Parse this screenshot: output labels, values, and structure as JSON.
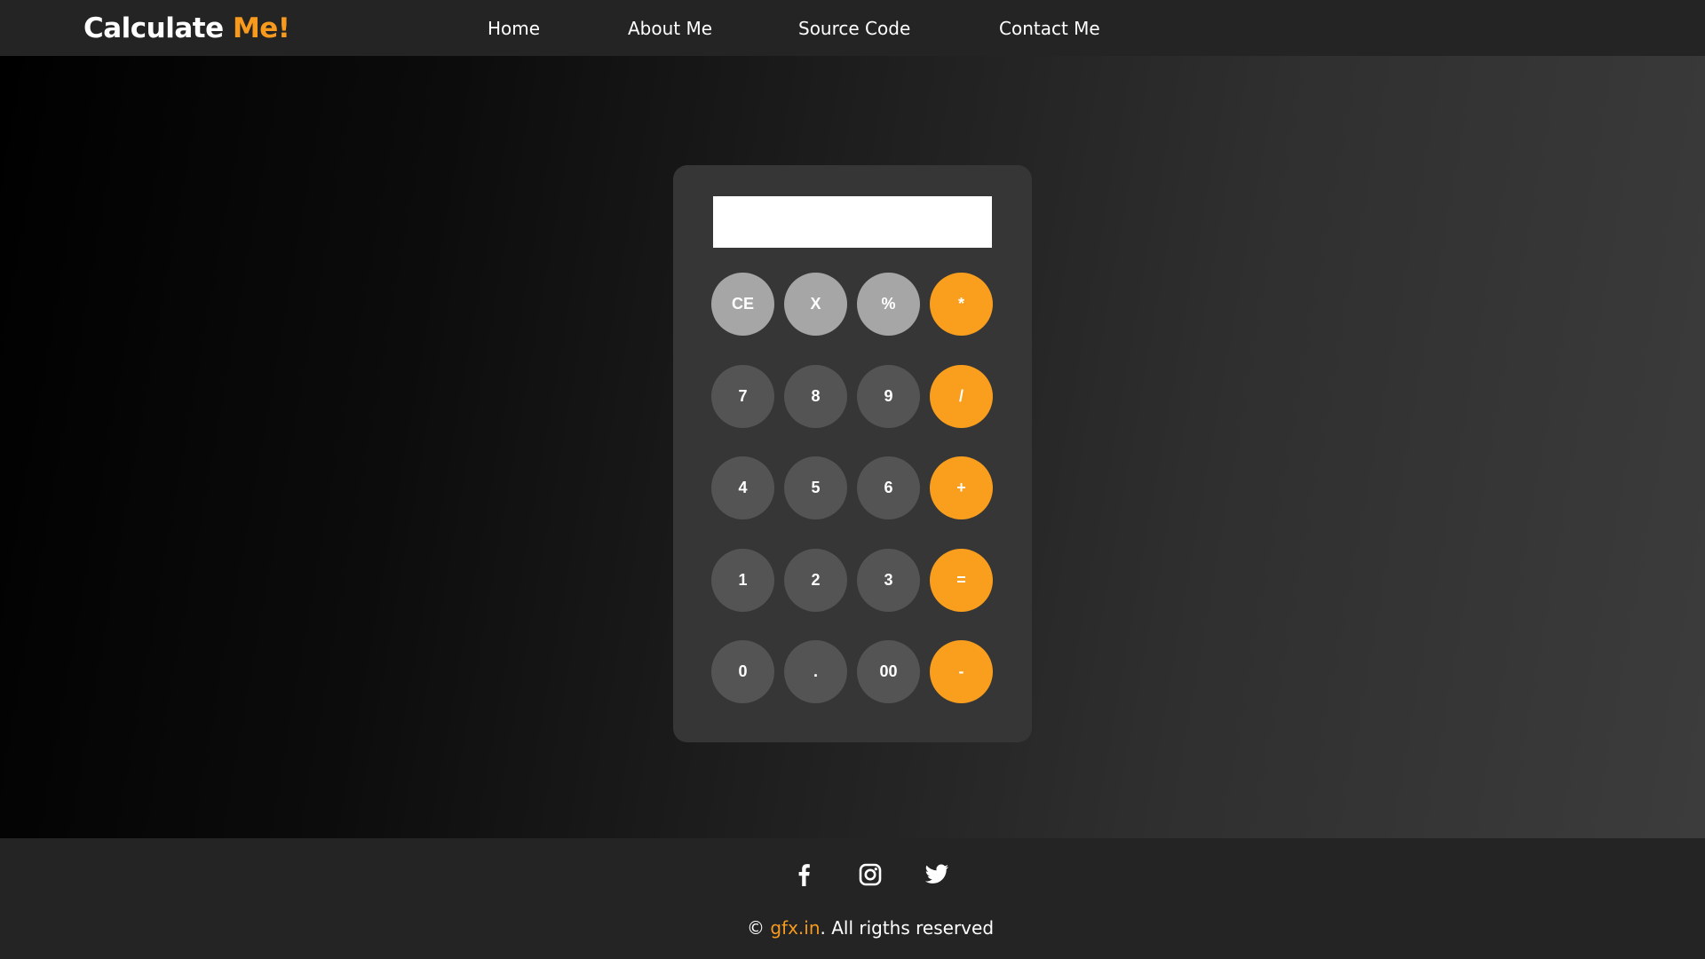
{
  "header": {
    "brand_main": "Calculate",
    "brand_accent": "Me!",
    "nav": [
      "Home",
      "About Me",
      "Source Code",
      "Contact Me"
    ]
  },
  "calculator": {
    "display_value": "",
    "rows": [
      [
        {
          "label": "CE",
          "style": "light"
        },
        {
          "label": "X",
          "style": "light"
        },
        {
          "label": "%",
          "style": "light"
        },
        {
          "label": "*",
          "style": "orange"
        }
      ],
      [
        {
          "label": "7",
          "style": "dark"
        },
        {
          "label": "8",
          "style": "dark"
        },
        {
          "label": "9",
          "style": "dark"
        },
        {
          "label": "/",
          "style": "orange"
        }
      ],
      [
        {
          "label": "4",
          "style": "dark"
        },
        {
          "label": "5",
          "style": "dark"
        },
        {
          "label": "6",
          "style": "dark"
        },
        {
          "label": "+",
          "style": "orange"
        }
      ],
      [
        {
          "label": "1",
          "style": "dark"
        },
        {
          "label": "2",
          "style": "dark"
        },
        {
          "label": "3",
          "style": "dark"
        },
        {
          "label": "=",
          "style": "orange"
        }
      ],
      [
        {
          "label": "0",
          "style": "dark"
        },
        {
          "label": ".",
          "style": "dark"
        },
        {
          "label": "00",
          "style": "dark"
        },
        {
          "label": "-",
          "style": "orange"
        }
      ]
    ]
  },
  "footer": {
    "social": [
      "facebook-icon",
      "instagram-icon",
      "twitter-icon"
    ],
    "copyright_prefix": "©",
    "site": "gfx.in",
    "copyright_suffix": ". All rigths reserved"
  },
  "colors": {
    "accent": "#f79a1e",
    "key_light": "#a6a6a6",
    "key_dark": "#545454",
    "key_orange": "#fa9e1e",
    "calculator_body": "#363636",
    "bar_bg": "#242424"
  }
}
